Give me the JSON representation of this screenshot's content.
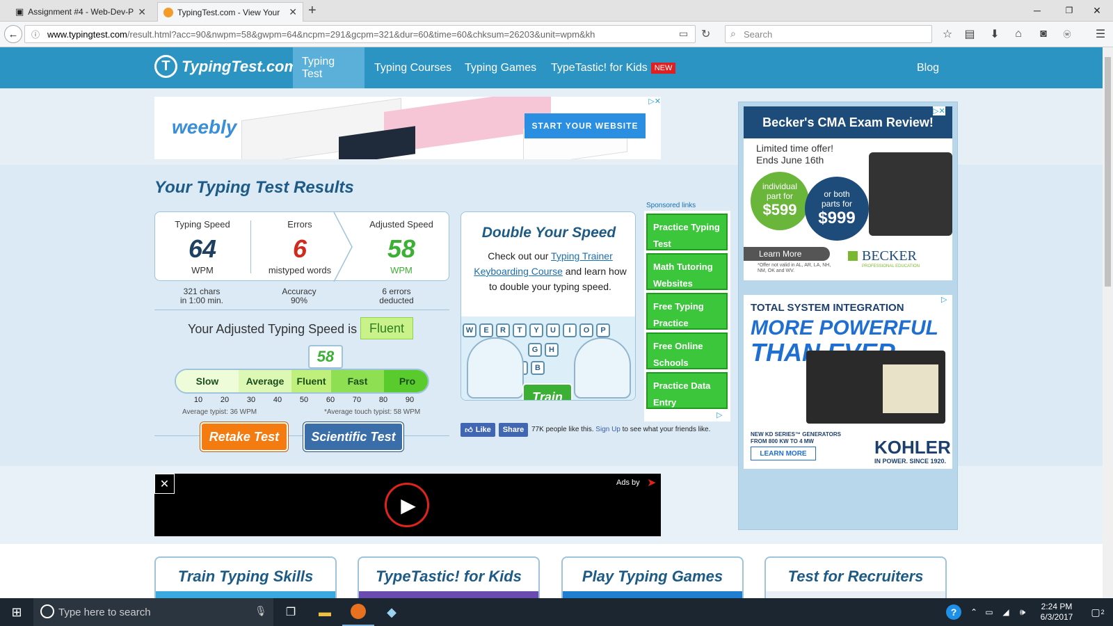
{
  "browser": {
    "tabs": [
      {
        "title": "Assignment #4 - Web-Dev-P"
      },
      {
        "title": "TypingTest.com - View Your"
      }
    ],
    "new_tab": "+",
    "url_host": "www.typingtest.com",
    "url_rest": "/result.html?acc=90&nwpm=58&gwpm=64&ncpm=291&gcpm=321&dur=60&time=60&chksum=26203&unit=wpm&kh",
    "search_placeholder": "Search"
  },
  "site": {
    "logo_text": "TypingTest.com",
    "logo_mark": "T",
    "nav": [
      {
        "label": "Typing Test"
      },
      {
        "label": "Typing Courses"
      },
      {
        "label": "Typing Games"
      },
      {
        "label": "TypeTastic! for Kids"
      }
    ],
    "new_badge": "NEW",
    "blog": "Blog"
  },
  "banner_ad": {
    "brand": "weebly",
    "cta": "START YOUR WEBSITE"
  },
  "results": {
    "title": "Your Typing Test Results",
    "typing_speed_label": "Typing Speed",
    "typing_speed_value": "64",
    "typing_speed_unit": "WPM",
    "errors_label": "Errors",
    "errors_value": "6",
    "errors_unit": "mistyped words",
    "adjusted_label": "Adjusted Speed",
    "adjusted_value": "58",
    "adjusted_unit": "WPM",
    "chars_line1": "321 chars",
    "chars_line2": "in 1:00 min.",
    "accuracy_line1": "Accuracy",
    "accuracy_line2": "90%",
    "deducted_line1": "6 errors",
    "deducted_line2": "deducted",
    "adjusted_is": "Your Adjusted Typing Speed is",
    "level": "Fluent",
    "marker_value": "58",
    "scale_segments": [
      "Slow",
      "Average",
      "Fluent",
      "Fast",
      "Pro"
    ],
    "ticks": [
      "10",
      "20",
      "30",
      "40",
      "50",
      "60",
      "70",
      "80",
      "90"
    ],
    "avg_typist": "Average typist: 36 WPM",
    "avg_touch": "*Average touch typist: 58 WPM",
    "retake": "Retake Test",
    "scientific": "Scientific Test"
  },
  "double": {
    "title": "Double Your Speed",
    "text1": "Check out our",
    "link1": "Typing Trainer",
    "link2": "Keyboarding Course",
    "text2": "and learn how to double your typing speed.",
    "keys_row1": [
      "W",
      "E",
      "R",
      "T",
      "Y",
      "U",
      "I",
      "O",
      "P"
    ],
    "keys_row2": [
      "G",
      "H"
    ],
    "keys_row3": [
      "V",
      "B"
    ],
    "train": "Train"
  },
  "sponsored": {
    "heading": "Sponsored links",
    "links": [
      "Practice Typing Test",
      "Math Tutoring Websites",
      "Free Typing Practice",
      "Free Online Schools",
      "Practice Data Entry"
    ]
  },
  "social": {
    "like": "Like",
    "share": "Share",
    "count_text": "77K people like this.",
    "signup": "Sign Up",
    "signup_rest": "to see what your friends like."
  },
  "becker_ad": {
    "title": "Becker's CMA Exam Review!",
    "offer1": "Limited time offer!",
    "offer2": "Ends June 16th",
    "c1_l1": "individual",
    "c1_l2": "part for",
    "c1_price": "$599",
    "c2_l1": "or both",
    "c2_l2": "parts for",
    "c2_price": "$999",
    "learn": "Learn More",
    "fine": "*Offer not valid in AL, AR, LA, NH, NM, OK and WV.",
    "brand": "BECKER",
    "brand_sub": "PROFESSIONAL EDUCATION"
  },
  "kohler_ad": {
    "head": "TOTAL SYSTEM INTEGRATION",
    "big1": "MORE POWERFUL",
    "big2": "THAN EVER.",
    "small1": "NEW KD SERIES™ GENERATORS",
    "small2": "FROM 800 KW TO 4 MW",
    "learn": "LEARN MORE",
    "brand": "KOHLER",
    "tag": "IN POWER. SINCE 1920."
  },
  "video_ad": {
    "close": "✕",
    "ads_by": "Ads by"
  },
  "cards": [
    "Train Typing Skills",
    "TypeTastic! for Kids",
    "Play Typing Games",
    "Test for Recruiters"
  ],
  "taskbar": {
    "search": "Type here to search",
    "time": "2:24 PM",
    "date": "6/3/2017",
    "notif": "2"
  },
  "colors": {
    "header": "#2c94c3",
    "green": "#3cc63c",
    "orange": "#f47b0f",
    "blue_btn": "#3a6ea8"
  }
}
